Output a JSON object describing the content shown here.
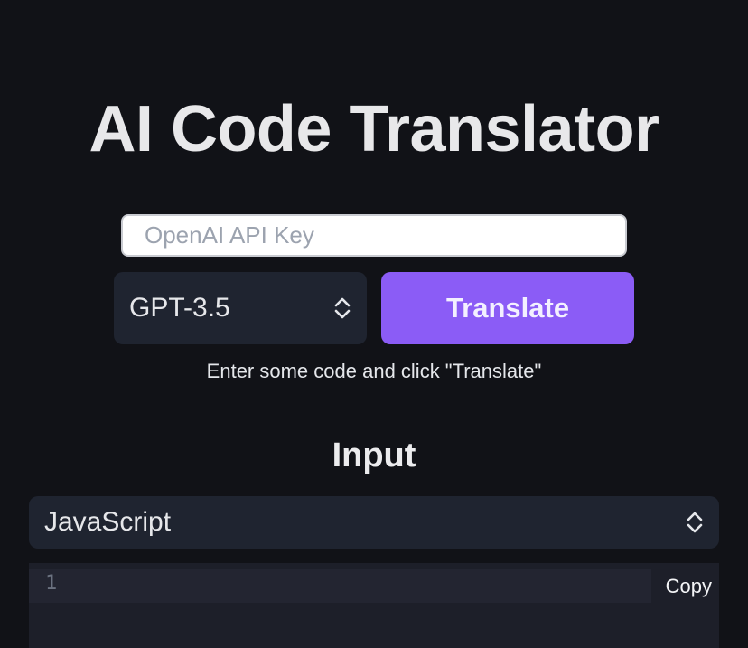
{
  "header": {
    "title": "AI Code Translator"
  },
  "controls": {
    "api_key_placeholder": "OpenAI API Key",
    "api_key_value": "",
    "model_selected": "GPT-3.5",
    "translate_label": "Translate",
    "hint": "Enter some code and click \"Translate\""
  },
  "input_section": {
    "title": "Input",
    "language_selected": "JavaScript",
    "editor": {
      "line_numbers": [
        "1"
      ],
      "content": ""
    },
    "copy_label": "Copy"
  },
  "icons": {
    "select_arrow": "chevron-up-down-icon"
  },
  "colors": {
    "background": "#111217",
    "accent": "#8b5cf6",
    "panel": "#1f2430"
  }
}
